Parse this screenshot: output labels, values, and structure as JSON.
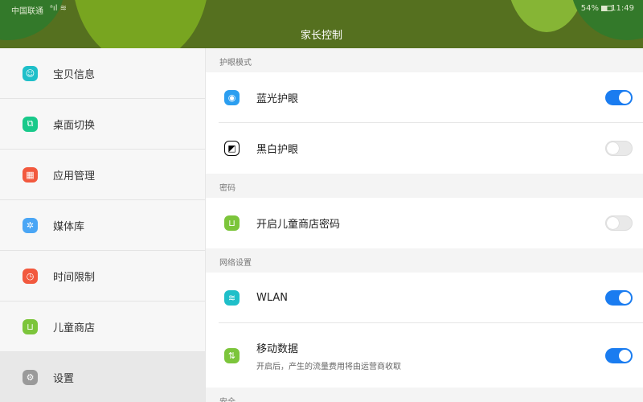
{
  "status": {
    "carrier": "中国联通",
    "battery": "54%",
    "time": "11:49"
  },
  "header": {
    "title": "家长控制"
  },
  "sidebar": {
    "items": [
      {
        "label": "宝贝信息",
        "color": "#1fbfc9",
        "glyph": "☺"
      },
      {
        "label": "桌面切换",
        "color": "#19c98a",
        "glyph": "⧉"
      },
      {
        "label": "应用管理",
        "color": "#f2593e",
        "glyph": "▦"
      },
      {
        "label": "媒体库",
        "color": "#4aa6f5",
        "glyph": "✲"
      },
      {
        "label": "时间限制",
        "color": "#f2593e",
        "glyph": "◷"
      },
      {
        "label": "儿童商店",
        "color": "#7cc53b",
        "glyph": "⊔"
      },
      {
        "label": "设置",
        "color": "#9a9a9a",
        "glyph": "⚙"
      }
    ],
    "selected": "设置"
  },
  "main": {
    "sections": [
      {
        "title": "护眼模式",
        "rows": [
          {
            "label": "蓝光护眼",
            "on": true
          },
          {
            "label": "黑白护眼",
            "on": false
          }
        ]
      },
      {
        "title": "密码",
        "rows": [
          {
            "label": "开启儿童商店密码",
            "on": false
          }
        ]
      },
      {
        "title": "网络设置",
        "rows": [
          {
            "label": "WLAN",
            "on": true
          },
          {
            "label": "移动数据",
            "sub": "开启后，产生的流量费用将由运营商收取",
            "on": true
          }
        ]
      },
      {
        "title": "安全"
      }
    ]
  }
}
